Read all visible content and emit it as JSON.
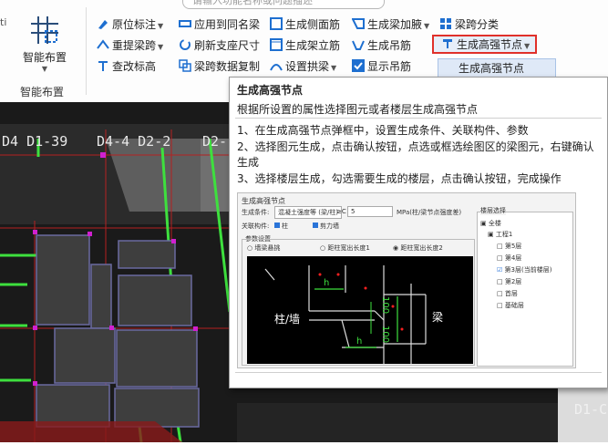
{
  "search": {
    "placeholder": "请输入功能名称或问题描述"
  },
  "left_stub": "ti",
  "smart_layout": {
    "label": "智能布置",
    "group_label": "智能布置"
  },
  "toolbar": {
    "col1": [
      {
        "label": "原位标注",
        "dropdown": true
      },
      {
        "label": "重提梁跨",
        "dropdown": true
      },
      {
        "label": "查改标高",
        "dropdown": false
      }
    ],
    "col2": [
      {
        "label": "应用到同名梁"
      },
      {
        "label": "刷新支座尺寸"
      },
      {
        "label": "梁跨数据复制"
      }
    ],
    "col3": [
      {
        "label": "生成侧面筋"
      },
      {
        "label": "生成架立筋"
      },
      {
        "label": "设置拱梁",
        "dropdown": true
      }
    ],
    "col4": [
      {
        "label": "生成梁加腋",
        "dropdown": true
      },
      {
        "label": "生成吊筋"
      },
      {
        "label": "显示吊筋",
        "checked": true
      }
    ],
    "col5": [
      {
        "label": "梁跨分类"
      },
      {
        "label": "生成高强节点",
        "dropdown": true
      }
    ]
  },
  "dropdown_item": "生成高强节点",
  "canvas_labels": [
    "D4 D1-39",
    "D4-4 D2-2",
    "D2-",
    "D1-C"
  ],
  "tooltip": {
    "title": "生成高强节点",
    "subtitle": "根据所设置的属性选择图元或者楼层生成高强节点",
    "steps": [
      "1、在生成高强节点弹框中，设置生成条件、关联构件、参数",
      "2、选择图元生成，点击确认按钮，点选或框选绘图区的梁图元，右键确认生成",
      "3、选择楼层生成，勾选需要生成的楼层，点击确认按钮，完成操作"
    ],
    "dialog": {
      "title": "生成高强节点",
      "cond_label": "生成条件:",
      "cond_value": "混凝土强度等 (梁/柱)",
      "cond_op": "≥C",
      "cond_num": "5",
      "cond_unit": "MPa(柱/梁节点强度差)",
      "rel_label": "关联构件:",
      "rel_opts": [
        "柱",
        "剪力墙"
      ],
      "param_label": "参数设置",
      "radios": [
        "墙梁悬挑",
        "距柱宽出长度1",
        "距柱宽出长度2"
      ],
      "floor_title": "楼层选择",
      "floors": [
        "全楼",
        "工程1",
        "第5层",
        "第4层",
        "第3层(当前楼层)",
        "第2层",
        "首层",
        "基础层"
      ],
      "cad_label_column": "柱/墙",
      "cad_label_beam": "梁",
      "cad_h": "h",
      "cad_dim": "100"
    }
  },
  "colors": {
    "accent": "#1e6fd0",
    "red_highlight": "#e0302a",
    "canvas_bg": "#1a1a1a",
    "cad_green": "#3ee03e",
    "cad_red": "#ff2020"
  }
}
